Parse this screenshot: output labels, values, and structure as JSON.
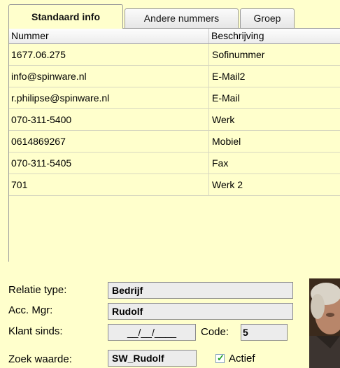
{
  "tabs": [
    {
      "label": "Standaard info",
      "active": true
    },
    {
      "label": "Andere nummers",
      "active": false
    },
    {
      "label": "Groep",
      "active": false
    }
  ],
  "grid": {
    "columns": [
      "Nummer",
      "Beschrijving"
    ],
    "rows": [
      [
        "1677.06.275",
        "Sofinummer"
      ],
      [
        "info@spinware.nl",
        "E-Mail2"
      ],
      [
        "r.philipse@spinware.nl",
        "E-Mail"
      ],
      [
        "070-311-5400",
        "Werk"
      ],
      [
        "0614869267",
        "Mobiel"
      ],
      [
        "070-311-5405",
        "Fax"
      ],
      [
        "701",
        "Werk 2"
      ]
    ]
  },
  "form": {
    "relatie_type_label": "Relatie type:",
    "relatie_type_value": "Bedrijf",
    "acc_mgr_label": "Acc. Mgr:",
    "acc_mgr_value": "Rudolf",
    "klant_sinds_label": "Klant sinds:",
    "klant_sinds_value": "__/__/____",
    "code_label": "Code:",
    "code_value": "5",
    "zoek_waarde_label": "Zoek waarde:",
    "zoek_waarde_value": "SW_Rudolf",
    "actief_label": "Actief",
    "actief_checked": true
  },
  "colors": {
    "background": "#ffffcc",
    "field_bg": "#ececec",
    "check_color": "#21a121"
  }
}
